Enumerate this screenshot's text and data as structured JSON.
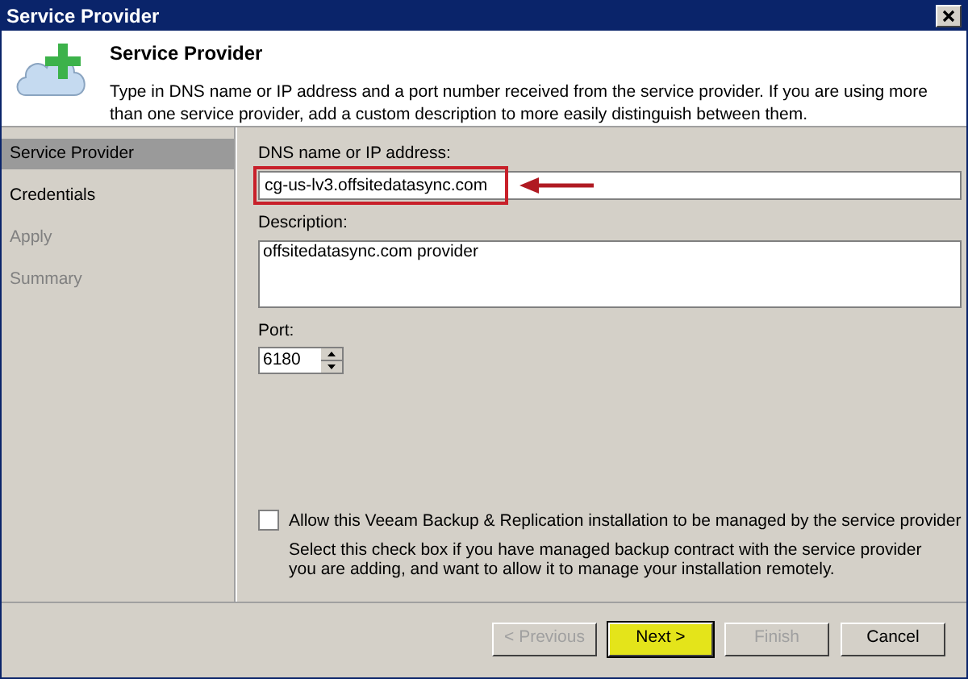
{
  "window": {
    "title": "Service Provider"
  },
  "header": {
    "title": "Service Provider",
    "description": "Type in DNS name or IP address and a port number received from the service provider. If you are using more than one service provider, add a custom description to more easily distinguish between them."
  },
  "steps": [
    {
      "label": "Service Provider",
      "selected": true,
      "disabled": false
    },
    {
      "label": "Credentials",
      "selected": false,
      "disabled": false
    },
    {
      "label": "Apply",
      "selected": false,
      "disabled": true
    },
    {
      "label": "Summary",
      "selected": false,
      "disabled": true
    }
  ],
  "dns": {
    "label": "DNS name or IP address:",
    "value": "cg-us-lv3.offsitedatasync.com",
    "highlighted": true
  },
  "description": {
    "label": "Description:",
    "value": "offsitedatasync.com provider"
  },
  "port": {
    "label": "Port:",
    "value": "6180"
  },
  "managed": {
    "label": "Allow this Veeam Backup & Replication installation to be managed by the service provider",
    "checked": false,
    "hint": "Select this check box if you have managed backup contract with the service provider you are adding, and want to allow it to manage your installation remotely."
  },
  "buttons": [
    {
      "label": "< Previous",
      "disabled": true,
      "highlighted": false
    },
    {
      "label": "Next >",
      "disabled": false,
      "highlighted": true
    },
    {
      "label": "Finish",
      "disabled": true,
      "highlighted": false
    },
    {
      "label": "Cancel",
      "disabled": false,
      "highlighted": false
    }
  ]
}
